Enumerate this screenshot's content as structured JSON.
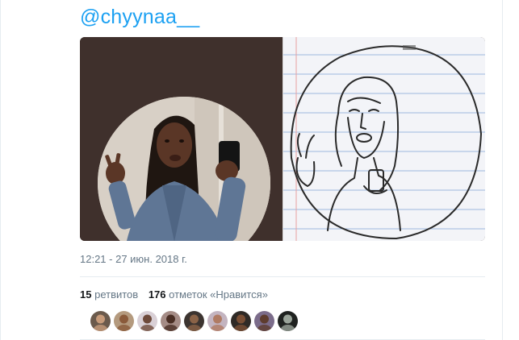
{
  "tweet": {
    "handle": "@chyynaa__",
    "timestamp": "12:21 - 27 июн. 2018 г."
  },
  "media": {
    "left_image": "selfie-photo",
    "right_image": "pencil-sketch-drawing"
  },
  "stats": {
    "retweets_count": "15",
    "retweets_label": "ретвитов",
    "likes_count": "176",
    "likes_label": "отметок «Нравится»"
  },
  "likers": [
    {
      "name": "liker-avatar-1",
      "bg": "#6b5a4c",
      "face": "#c79b7a"
    },
    {
      "name": "liker-avatar-2",
      "bg": "#b49a7e",
      "face": "#8a5a3a"
    },
    {
      "name": "liker-avatar-3",
      "bg": "#d9d0d6",
      "face": "#6e4a3a"
    },
    {
      "name": "liker-avatar-4",
      "bg": "#a58c86",
      "face": "#4a2e24"
    },
    {
      "name": "liker-avatar-5",
      "bg": "#3c3430",
      "face": "#8b6347"
    },
    {
      "name": "liker-avatar-6",
      "bg": "#c3b4c0",
      "face": "#b07b63"
    },
    {
      "name": "liker-avatar-7",
      "bg": "#2f2a26",
      "face": "#7a4f35"
    },
    {
      "name": "liker-avatar-8",
      "bg": "#7b6c8a",
      "face": "#5e3c2e"
    },
    {
      "name": "liker-avatar-9",
      "bg": "#1f2220",
      "face": "#9aa49a"
    }
  ],
  "colors": {
    "accent": "#1da1f2",
    "muted_text": "#657786",
    "divider": "#e6ecf0"
  }
}
